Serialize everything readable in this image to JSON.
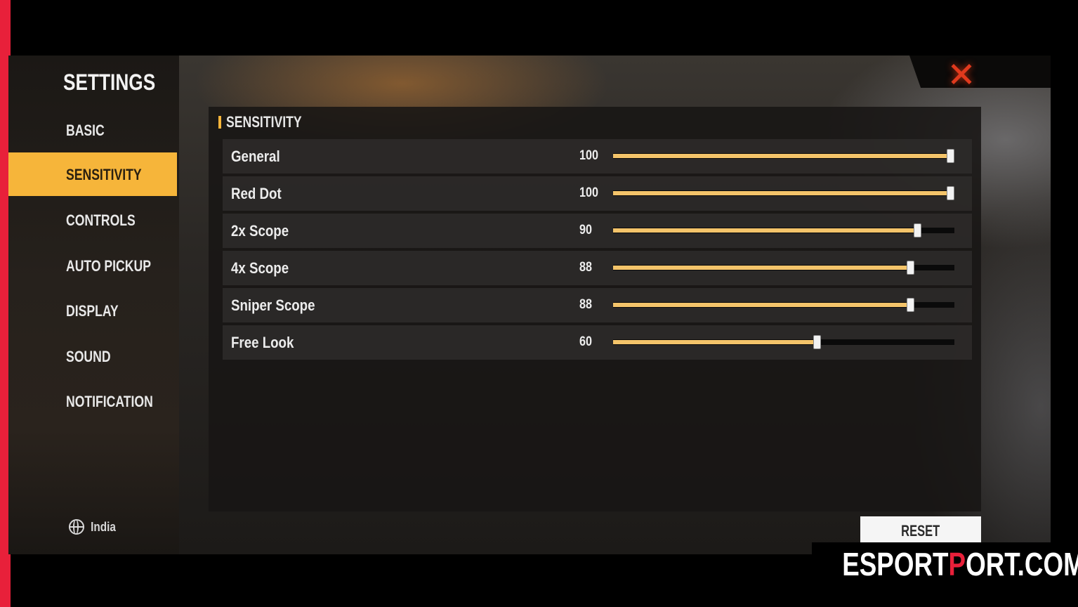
{
  "window": {
    "title": "SETTINGS"
  },
  "sidebar": {
    "items": [
      {
        "label": "BASIC",
        "active": false
      },
      {
        "label": "SENSITIVITY",
        "active": true
      },
      {
        "label": "CONTROLS",
        "active": false
      },
      {
        "label": "AUTO PICKUP",
        "active": false
      },
      {
        "label": "DISPLAY",
        "active": false
      },
      {
        "label": "SOUND",
        "active": false
      },
      {
        "label": "NOTIFICATION",
        "active": false
      }
    ],
    "region": {
      "icon": "globe-icon",
      "label": "India"
    }
  },
  "panel": {
    "header": "SENSITIVITY",
    "sliders": [
      {
        "label": "General",
        "value": 100,
        "max": 100
      },
      {
        "label": "Red Dot",
        "value": 100,
        "max": 100
      },
      {
        "label": "2x Scope",
        "value": 90,
        "max": 100
      },
      {
        "label": "4x Scope",
        "value": 88,
        "max": 100
      },
      {
        "label": "Sniper Scope",
        "value": 88,
        "max": 100
      },
      {
        "label": "Free Look",
        "value": 60,
        "max": 100
      }
    ]
  },
  "buttons": {
    "reset": "RESET",
    "close_icon": "close-icon"
  },
  "watermark": {
    "before": "ESPORT",
    "highlight": "P",
    "after": "ORT.COM"
  },
  "colors": {
    "accent": "#f6b53a",
    "slider_fill": "#f4c46a",
    "close": "#e03a1e",
    "brand_red": "#e8203a"
  }
}
